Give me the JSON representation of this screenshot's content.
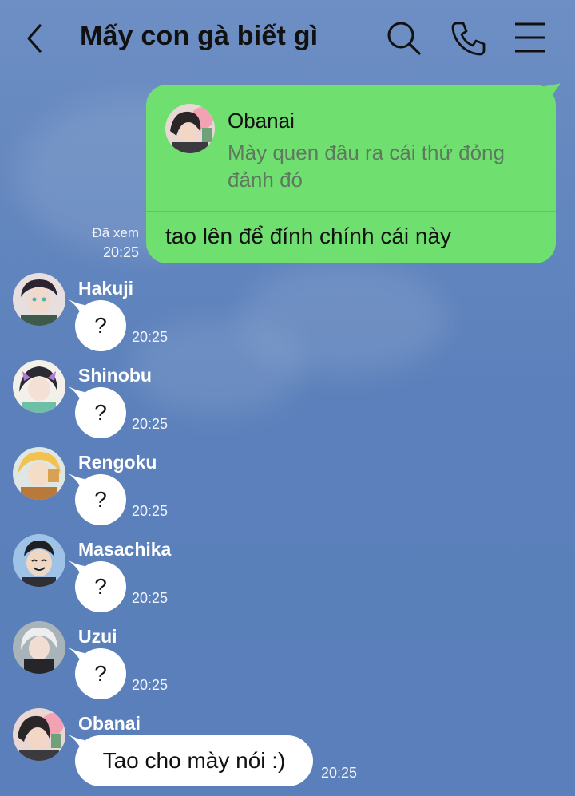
{
  "header": {
    "title": "Mấy con gà biết gì"
  },
  "sent": {
    "reply_to_name": "Obanai",
    "reply_to_text": "Mày quen đâu ra cái thứ đỏng đảnh đó",
    "text": "tao lên để đính chính cái này",
    "read_status": "Đã xem",
    "time": "20:25"
  },
  "messages": [
    {
      "sender": "Hakuji",
      "text": "?",
      "time": "20:25"
    },
    {
      "sender": "Shinobu",
      "text": "?",
      "time": "20:25"
    },
    {
      "sender": "Rengoku",
      "text": "?",
      "time": "20:25"
    },
    {
      "sender": "Masachika",
      "text": "?",
      "time": "20:25"
    },
    {
      "sender": "Uzui",
      "text": "?",
      "time": "20:25"
    },
    {
      "sender": "Obanai",
      "text": "Tao cho mày nói :)",
      "time": "20:25"
    }
  ],
  "colors": {
    "background": "#5b80bb",
    "sent_bubble": "#6fe06f",
    "received_bubble": "#ffffff"
  },
  "icons": [
    "back-icon",
    "search-icon",
    "phone-icon",
    "menu-icon"
  ]
}
